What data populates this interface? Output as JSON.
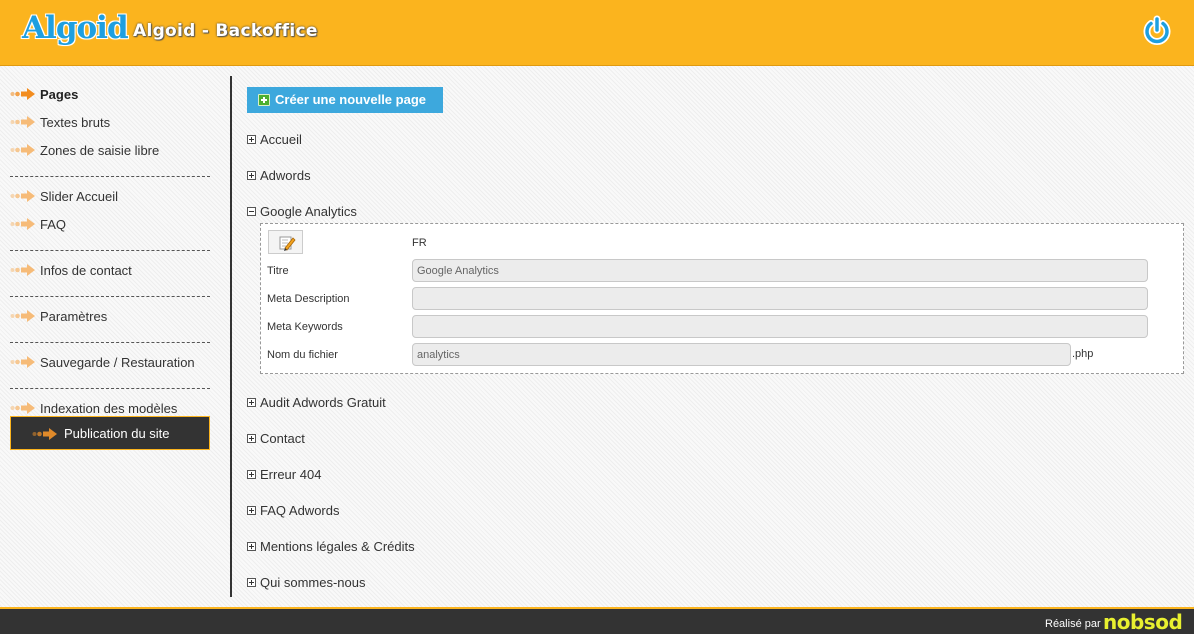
{
  "header": {
    "logo": "Algoid",
    "title": "Algoid - Backoffice",
    "power_icon": "power-icon"
  },
  "sidebar": {
    "items": [
      {
        "label": "Pages",
        "active": true
      },
      {
        "label": "Textes bruts"
      },
      {
        "label": "Zones de saisie libre"
      },
      {
        "label": "Slider Accueil"
      },
      {
        "label": "FAQ"
      },
      {
        "label": "Infos de contact"
      },
      {
        "label": "Paramètres"
      },
      {
        "label": "Sauvegarde / Restauration"
      },
      {
        "label": "Indexation des modèles"
      }
    ],
    "publish_label": "Publication du site",
    "arrow_icon": "arrow-right-icon"
  },
  "main": {
    "create_label": "Créer une nouvelle page",
    "pages": [
      {
        "label": "Accueil",
        "expanded": false
      },
      {
        "label": "Adwords",
        "expanded": false
      },
      {
        "label": "Google Analytics",
        "expanded": true
      },
      {
        "label": "Audit Adwords Gratuit",
        "expanded": false
      },
      {
        "label": "Contact",
        "expanded": false
      },
      {
        "label": "Erreur 404",
        "expanded": false
      },
      {
        "label": "FAQ Adwords",
        "expanded": false
      },
      {
        "label": "Mentions légales & Crédits",
        "expanded": false
      },
      {
        "label": "Qui sommes-nous",
        "expanded": false
      }
    ],
    "detail": {
      "lang": "FR",
      "fields": [
        {
          "label": "Titre",
          "value": "Google Analytics"
        },
        {
          "label": "Meta Description",
          "value": ""
        },
        {
          "label": "Meta Keywords",
          "value": ""
        },
        {
          "label": "Nom du fichier",
          "value": "analytics"
        }
      ],
      "filename_suffix": ".php"
    }
  },
  "footer": {
    "credit": "Réalisé par",
    "brand": "nobsod"
  },
  "colors": {
    "header_bg": "#fbb41e",
    "accent_blue": "#3da8dd",
    "dark": "#333333",
    "arrow_orange": "#f28c1e"
  }
}
